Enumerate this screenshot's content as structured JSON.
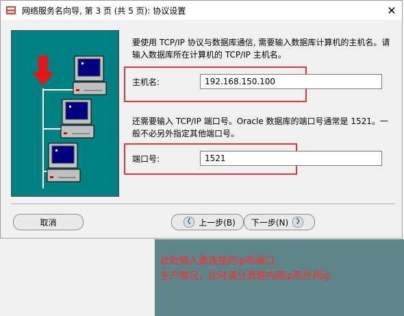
{
  "window": {
    "title": "网络服务名向导, 第 3 页 (共 5 页): 协议设置",
    "close_glyph": "✕"
  },
  "main": {
    "intro_text": "要使用 TCP/IP 协议与数据库通信, 需要输入数据库计算机的主机名。请输入数据库所在计算机的 TCP/IP 主机名。",
    "host_label": "主机名:",
    "host_value": "192.168.150.100",
    "port_intro": "还需要输入 TCP/IP 端口号。Oracle 数据库的端口号通常是 1521。一般不必另外指定其他端口号。",
    "port_label": "端口号:",
    "port_value": "1521"
  },
  "buttons": {
    "cancel": "取消",
    "back": "上一步(B)",
    "next": "下一步(N)"
  },
  "annotation": {
    "line1": "此处输入要连接的ip和端口,",
    "line2": "生产情况，此时请分清楚内网ip和外网ip"
  },
  "colors": {
    "illustration_bg": "#008080",
    "annotation_red": "#ff2a2a",
    "highlight_red": "#e8333a"
  },
  "icons": [
    "app-icon",
    "close-icon",
    "computer-icon",
    "down-arrow-icon",
    "back-arrow-icon",
    "forward-arrow-icon"
  ]
}
